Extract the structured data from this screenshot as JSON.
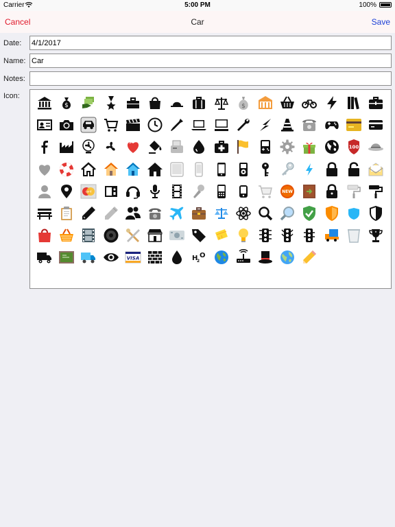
{
  "status_bar": {
    "carrier": "Carrier",
    "time": "5:00 PM",
    "battery": "100%"
  },
  "nav": {
    "cancel_label": "Cancel",
    "title": "Car",
    "save_label": "Save"
  },
  "form": {
    "date_label": "Date:",
    "date_value": "4/1/2017",
    "name_label": "Name:",
    "name_value": "Car",
    "notes_label": "Notes:",
    "notes_value": "",
    "icon_label": "Icon:"
  },
  "icon_rows": [
    [
      "bank-icon",
      "money-bag-icon",
      "cash-hand-icon",
      "medal-icon",
      "toolbox-icon",
      "shopping-bag-icon",
      "hat-icon",
      "suitcase-icon",
      "scales-icon",
      "money-sack-icon",
      "museum-icon",
      "basket-icon",
      "bicycle-icon",
      "lightning-icon",
      "books-icon",
      "first-aid-kit-icon"
    ],
    [
      "id-card-icon",
      "camera-icon",
      "car-icon",
      "shopping-cart-icon",
      "clapperboard-icon",
      "clock-icon",
      "eyedropper-icon",
      "laptop-icon",
      "computer-icon",
      "wrench-icon",
      "bolt-icon",
      "traffic-cone-icon",
      "telephone-icon",
      "gamepad-icon",
      "credit-card-gold-icon",
      "credit-card-icon"
    ],
    [
      "facebook-icon",
      "factory-icon",
      "fan-icon",
      "fan-outline-icon",
      "heart-icon",
      "paint-bucket-icon",
      "fax-icon",
      "water-drop-icon",
      "medical-kit-icon",
      "flag-icon",
      "game-boy-icon",
      "gear-icon",
      "gift-icon",
      "globe-icon",
      "badge-100-icon",
      "hat-grey-icon"
    ],
    [
      "heart-grey-icon",
      "lifebuoy-icon",
      "home-outline-icon",
      "house-icon",
      "house-blue-icon",
      "home-icon",
      "tablet-icon",
      "phone-outline-icon",
      "phone-icon",
      "ipod-icon",
      "key-icon",
      "key-silver-icon",
      "lightning-blue-icon",
      "lock-icon",
      "unlock-icon",
      "mail-icon"
    ],
    [
      "user-icon",
      "map-pin-icon",
      "mastercard-icon",
      "media-player-icon",
      "headset-icon",
      "microphone-icon",
      "film-strip-icon",
      "microphone-grey-icon",
      "mobile-icon",
      "cellphone-icon",
      "cart-grey-icon",
      "new-badge-icon",
      "exit-door-icon",
      "padlock-icon",
      "paint-roller-grey-icon",
      "paint-roller-icon"
    ],
    [
      "bench-icon",
      "clipboard-icon",
      "pencil-icon",
      "pencil-grey-icon",
      "people-icon",
      "telephone-grey-icon",
      "plane-icon",
      "briefcase-icon",
      "scales-blue-icon",
      "atom-icon",
      "magnifier-icon",
      "magnifier-blue-icon",
      "shield-check-icon",
      "shield-orange-icon",
      "shield-blue-icon",
      "shield-icon"
    ],
    [
      "shopping-bag-red-icon",
      "basket-orange-icon",
      "film-icon",
      "speaker-icon",
      "tools-icon",
      "shop-icon",
      "money-note-icon",
      "tag-icon",
      "ticket-icon",
      "lightbulb-icon",
      "traffic-light-icon",
      "traffic-light-2-icon",
      "traffic-light-3-icon",
      "truck-tipper-icon",
      "trash-icon",
      "trophy-icon"
    ],
    [
      "truck-icon",
      "chalkboard-icon",
      "truck-blue-icon",
      "eye-icon",
      "visa-icon",
      "brick-wall-icon",
      "drop-icon",
      "h2o-icon",
      "globe-blue-icon",
      "router-icon",
      "magic-hat-icon",
      "globe-blue-2-icon",
      "pencil-yellow-icon"
    ]
  ]
}
